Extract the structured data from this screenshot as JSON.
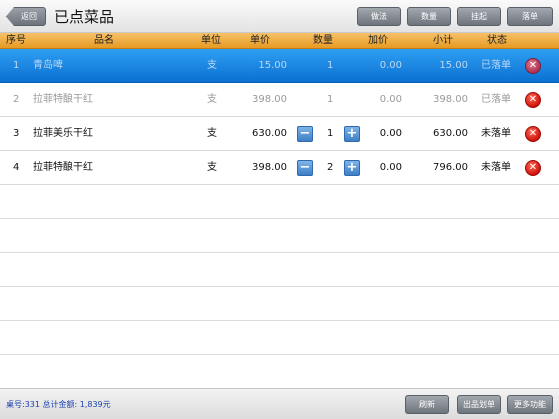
{
  "topbar": {
    "back_label": "返回",
    "title": "已点菜品",
    "buttons": [
      "做法",
      "数量",
      "挂起",
      "落单"
    ]
  },
  "table": {
    "headers": {
      "seq": "序号",
      "name": "品名",
      "unit": "单位",
      "price": "单价",
      "qty": "数量",
      "extra": "加价",
      "subtotal": "小计",
      "status": "状态"
    },
    "rows": [
      {
        "seq": "1",
        "name": "青岛啤",
        "unit": "支",
        "price": "15.00",
        "qty": "1",
        "extra": "0.00",
        "subtotal": "15.00",
        "status": "已落单"
      },
      {
        "seq": "2",
        "name": "拉菲特酿干红",
        "unit": "支",
        "price": "398.00",
        "qty": "1",
        "extra": "0.00",
        "subtotal": "398.00",
        "status": "已落单"
      },
      {
        "seq": "3",
        "name": "拉菲美乐干红",
        "unit": "支",
        "price": "630.00",
        "qty": "1",
        "extra": "0.00",
        "subtotal": "630.00",
        "status": "未落单"
      },
      {
        "seq": "4",
        "name": "拉菲特酿干红",
        "unit": "支",
        "price": "398.00",
        "qty": "2",
        "extra": "0.00",
        "subtotal": "796.00",
        "status": "未落单"
      }
    ]
  },
  "footer": {
    "info": "桌号:331 总计金额: 1,839元",
    "buttons": [
      "刷新",
      "出品划单",
      "更多功能"
    ]
  },
  "colors": {
    "header_orange": "#e69a22",
    "selected_blue": "#1a86e6",
    "delete_red": "#d0130b",
    "footer_text_blue": "#1a3fb0"
  }
}
